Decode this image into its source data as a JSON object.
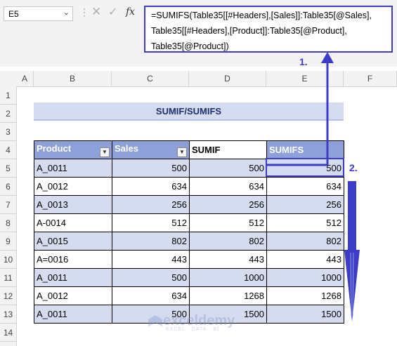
{
  "namebox": {
    "value": "E5"
  },
  "formula_lines": [
    "=SUMIFS(Table35[[#Headers],[Sales]]:Table35[@Sales],",
    "Table35[[#Headers],[Product]]:Table35[@Product],",
    "Table35[@Product])"
  ],
  "columns": [
    "A",
    "B",
    "C",
    "D",
    "E",
    "F"
  ],
  "rows": [
    "1",
    "2",
    "3",
    "4",
    "5",
    "6",
    "7",
    "8",
    "9",
    "10",
    "11",
    "12",
    "13",
    "14"
  ],
  "title": "SUMIF/SUMIFS",
  "table": {
    "headers": [
      "Product",
      "Sales",
      "SUMIF",
      "SUMIFS"
    ],
    "rows": [
      [
        "A_0011",
        "500",
        "500",
        "500"
      ],
      [
        "A_0012",
        "634",
        "634",
        "634"
      ],
      [
        "A_0013",
        "256",
        "256",
        "256"
      ],
      [
        "A-0014",
        "512",
        "512",
        "512"
      ],
      [
        "A_0015",
        "802",
        "802",
        "802"
      ],
      [
        "A=0016",
        "443",
        "443",
        "443"
      ],
      [
        "A_0011",
        "500",
        "1000",
        "1000"
      ],
      [
        "A_0012",
        "634",
        "1268",
        "1268"
      ],
      [
        "A_0011",
        "500",
        "1500",
        "1500"
      ]
    ]
  },
  "annotations": {
    "step1": "1.",
    "step2": "2."
  },
  "watermark": {
    "name": "exceldemy",
    "sub": "EXCEL · DATA · BI"
  },
  "colors": {
    "accent": "#3c3cc8",
    "header_blue": "#8ea0d8",
    "band": "#d6dcf0"
  }
}
